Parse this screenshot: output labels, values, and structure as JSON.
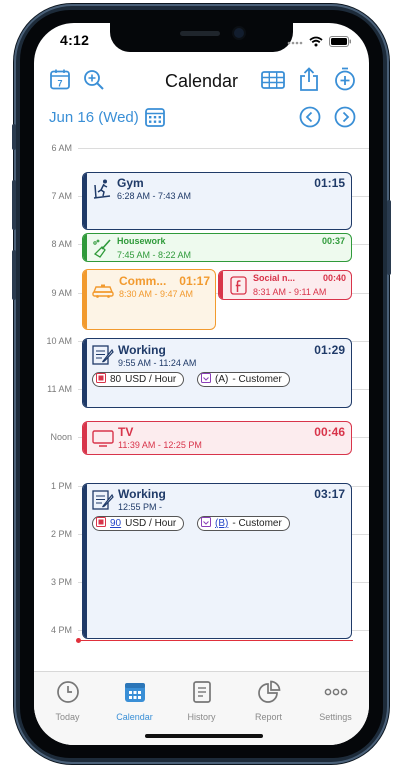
{
  "status": {
    "time": "4:12"
  },
  "header": {
    "title": "Calendar",
    "date": "Jun 16 (Wed)",
    "calendar_day_badge": "7"
  },
  "timeline": {
    "hours": [
      {
        "label": "6 AM"
      },
      {
        "label": "7 AM"
      },
      {
        "label": "8 AM"
      },
      {
        "label": "9 AM"
      },
      {
        "label": "10 AM"
      },
      {
        "label": "11 AM"
      },
      {
        "label": "Noon"
      },
      {
        "label": "1 PM"
      },
      {
        "label": "2 PM"
      },
      {
        "label": "3 PM"
      },
      {
        "label": "4 PM"
      }
    ]
  },
  "events": {
    "gym": {
      "name": "Gym",
      "time": "6:28 AM - 7:43 AM",
      "duration": "01:15",
      "icon": "treadmill-icon",
      "color": "#1f3a68",
      "bg": "#eef3fb"
    },
    "housework": {
      "name": "Housework",
      "time": "7:45 AM - 8:22 AM",
      "duration": "00:37",
      "icon": "broom-icon",
      "color": "#2f9a3a",
      "bg": "#eefaee"
    },
    "commute": {
      "name": "Comm...",
      "time": "8:30 AM - 9:47 AM",
      "duration": "01:17",
      "icon": "taxi-icon",
      "color": "#f29a2e",
      "bg": "#fdf4e6"
    },
    "social": {
      "name": "Social n...",
      "time": "8:31 AM - 9:11 AM",
      "duration": "00:40",
      "icon": "facebook-icon",
      "color": "#d8344a",
      "bg": "#fcecee"
    },
    "working1": {
      "name": "Working",
      "time": "9:55 AM - 11:24 AM",
      "duration": "01:29",
      "icon": "notepad-icon",
      "color": "#1f3a68",
      "bg": "#eef3fb",
      "rate_amount": "80",
      "rate_unit": "USD / Hour",
      "client_tag": "(A)",
      "client_suffix": "- Customer"
    },
    "tv": {
      "name": "TV",
      "time": "11:39 AM - 12:25 PM",
      "duration": "00:46",
      "icon": "tv-icon",
      "color": "#d8344a",
      "bg": "#fcecee"
    },
    "working2": {
      "name": "Working",
      "time": "12:55 PM -",
      "duration": "03:17",
      "icon": "notepad-icon",
      "color": "#1f3a68",
      "bg": "#eef3fb",
      "rate_amount": "90",
      "rate_unit": "USD / Hour",
      "client_tag": "(B)",
      "client_suffix": "- Customer"
    }
  },
  "tabs": [
    {
      "label": "Today",
      "icon": "clock-icon"
    },
    {
      "label": "Calendar",
      "icon": "calendar-grid-icon"
    },
    {
      "label": "History",
      "icon": "document-icon"
    },
    {
      "label": "Report",
      "icon": "pie-chart-icon"
    },
    {
      "label": "Settings",
      "icon": "ellipsis-icon"
    }
  ],
  "colors": {
    "accent": "#3a8fd6",
    "now": "#e0303b"
  }
}
